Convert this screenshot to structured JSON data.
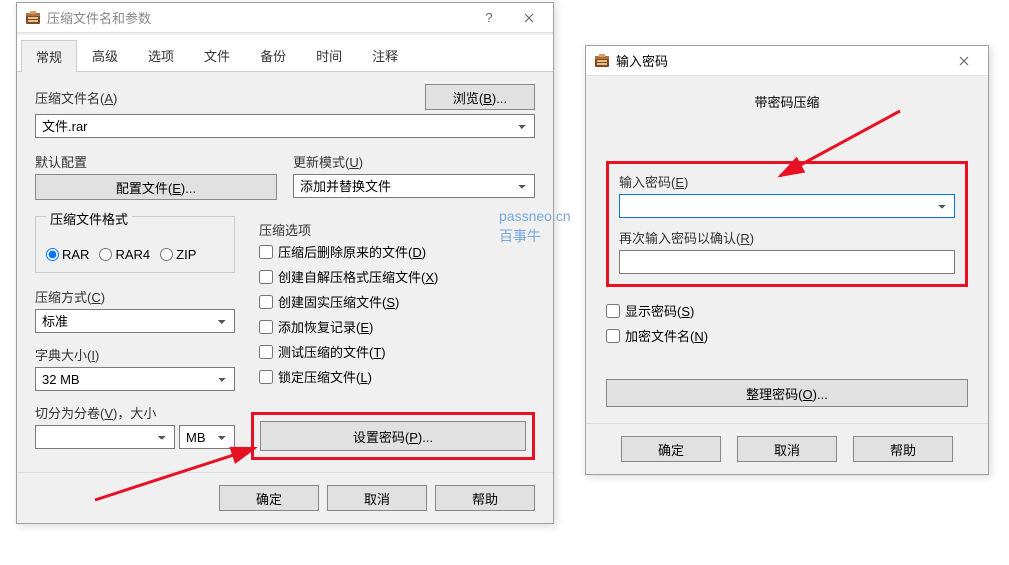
{
  "dialog1": {
    "title": "压缩文件名和参数",
    "tabs": [
      "常规",
      "高级",
      "选项",
      "文件",
      "备份",
      "时间",
      "注释"
    ],
    "filename_label": "压缩文件名(<u>A</u>)",
    "filename_value": "文件.rar",
    "browse": "浏览(<u>B</u>)...",
    "default_profile_label": "默认配置",
    "profile_btn": "配置文件(<u>E</u>)...",
    "update_mode_label": "更新模式(<u>U</u>)",
    "update_mode_value": "添加并替换文件",
    "format_label": "压缩文件格式",
    "formats": [
      "RAR",
      "RAR4",
      "ZIP"
    ],
    "options_label": "压缩选项",
    "opts": [
      "压缩后删除原来的文件(<u>D</u>)",
      "创建自解压格式压缩文件(<u>X</u>)",
      "创建固实压缩文件(<u>S</u>)",
      "添加恢复记录(<u>E</u>)",
      "测试压缩的文件(<u>T</u>)",
      "锁定压缩文件(<u>L</u>)"
    ],
    "method_label": "压缩方式(<u>C</u>)",
    "method_value": "标准",
    "dict_label": "字典大小(<u>I</u>)",
    "dict_value": "32 MB",
    "split_label": "切分为分卷(<u>V</u>)，大小",
    "split_unit": "MB",
    "set_password": "设置密码(<u>P</u>)...",
    "ok": "确定",
    "cancel": "取消",
    "help": "帮助"
  },
  "dialog2": {
    "title": "输入密码",
    "header": "带密码压缩",
    "enter_label": "输入密码(<u>E</u>)",
    "confirm_label": "再次输入密码以确认(<u>R</u>)",
    "show_pwd": "显示密码(<u>S</u>)",
    "encrypt_names": "加密文件名(<u>N</u>)",
    "organize": "整理密码(<u>O</u>)...",
    "ok": "确定",
    "cancel": "取消",
    "help": "帮助"
  },
  "watermark": {
    "line1": "passneo.cn",
    "line2": "百事牛"
  }
}
